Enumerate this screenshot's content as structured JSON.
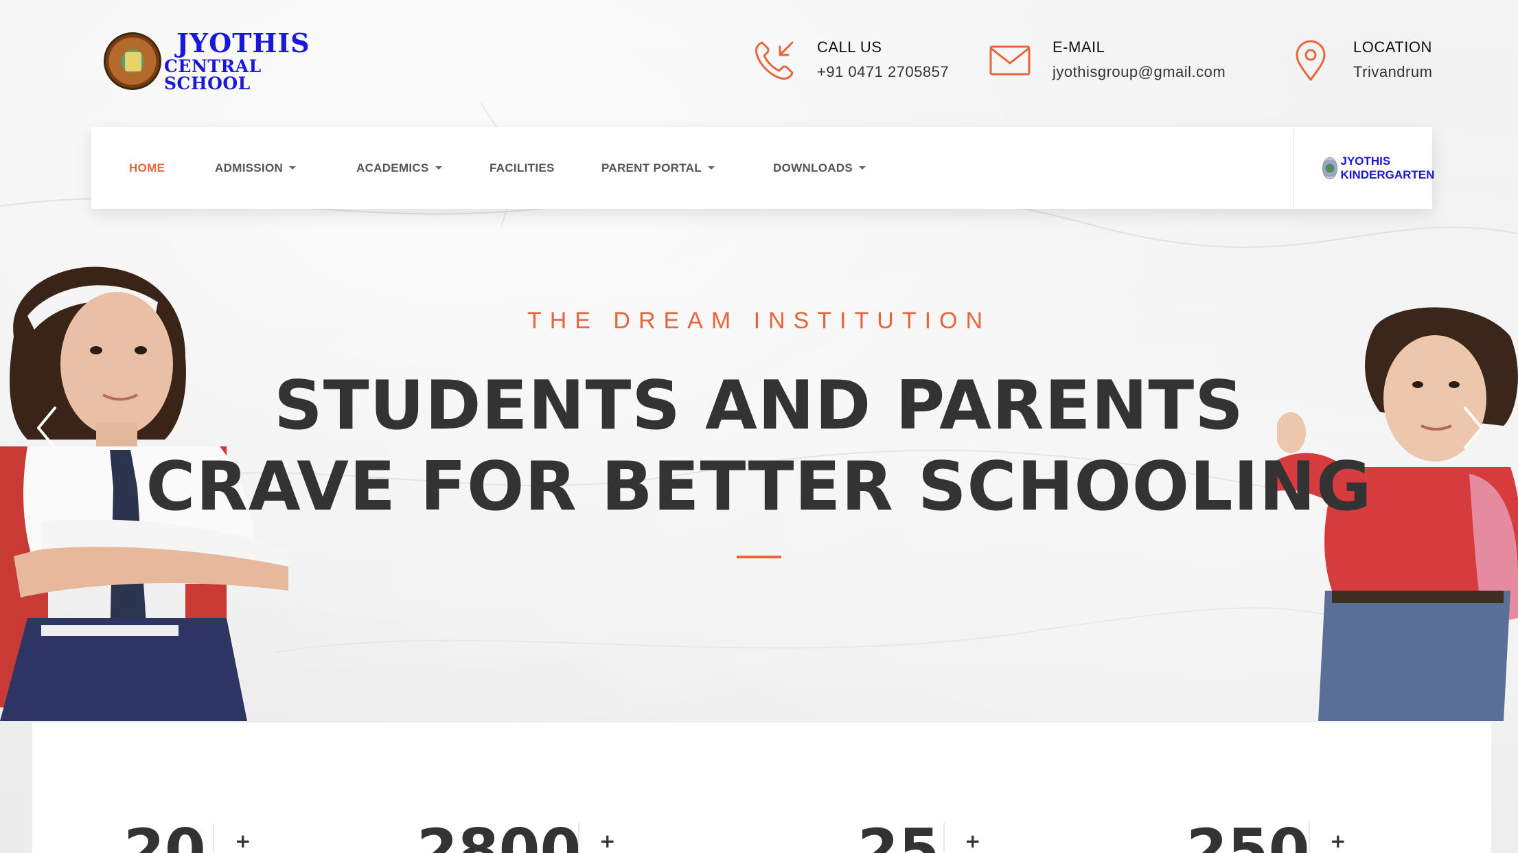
{
  "brand": {
    "line1": "JYOTHIS",
    "line2": "CENTRAL SCHOOL",
    "emblem_text": "JYOTHIS"
  },
  "contacts": [
    {
      "label": "CALL US",
      "value": "+91 0471 2705857",
      "icon": "phone-incoming-icon"
    },
    {
      "label": "E-MAIL",
      "value": "jyothisgroup@gmail.com",
      "icon": "envelope-icon"
    },
    {
      "label": "LOCATION",
      "value": "Trivandrum",
      "icon": "map-pin-icon"
    }
  ],
  "nav": {
    "items": [
      {
        "label": "HOME",
        "active": true,
        "dropdown": false
      },
      {
        "label": "ADMISSION",
        "active": false,
        "dropdown": true
      },
      {
        "label": "ACADEMICS",
        "active": false,
        "dropdown": true
      },
      {
        "label": "FACILITIES",
        "active": false,
        "dropdown": false
      },
      {
        "label": "PARENT PORTAL",
        "active": false,
        "dropdown": true
      },
      {
        "label": "DOWNLOADS",
        "active": false,
        "dropdown": true
      }
    ],
    "kindergarten_link": "JYOTHIS KINDERGARTEN"
  },
  "hero": {
    "tagline": "THE DREAM INSTITUTION",
    "headline_line1": "STUDENTS AND PARENTS",
    "headline_line2": "CRAVE FOR BETTER SCHOOLING"
  },
  "stats": [
    {
      "number": "20",
      "suffix": "+"
    },
    {
      "number": "2800",
      "suffix": "+"
    },
    {
      "number": "25",
      "suffix": "+"
    },
    {
      "number": "250",
      "suffix": "+"
    }
  ],
  "colors": {
    "accent": "#e8643a",
    "brand_blue": "#1a18d8",
    "heading": "#333333"
  }
}
